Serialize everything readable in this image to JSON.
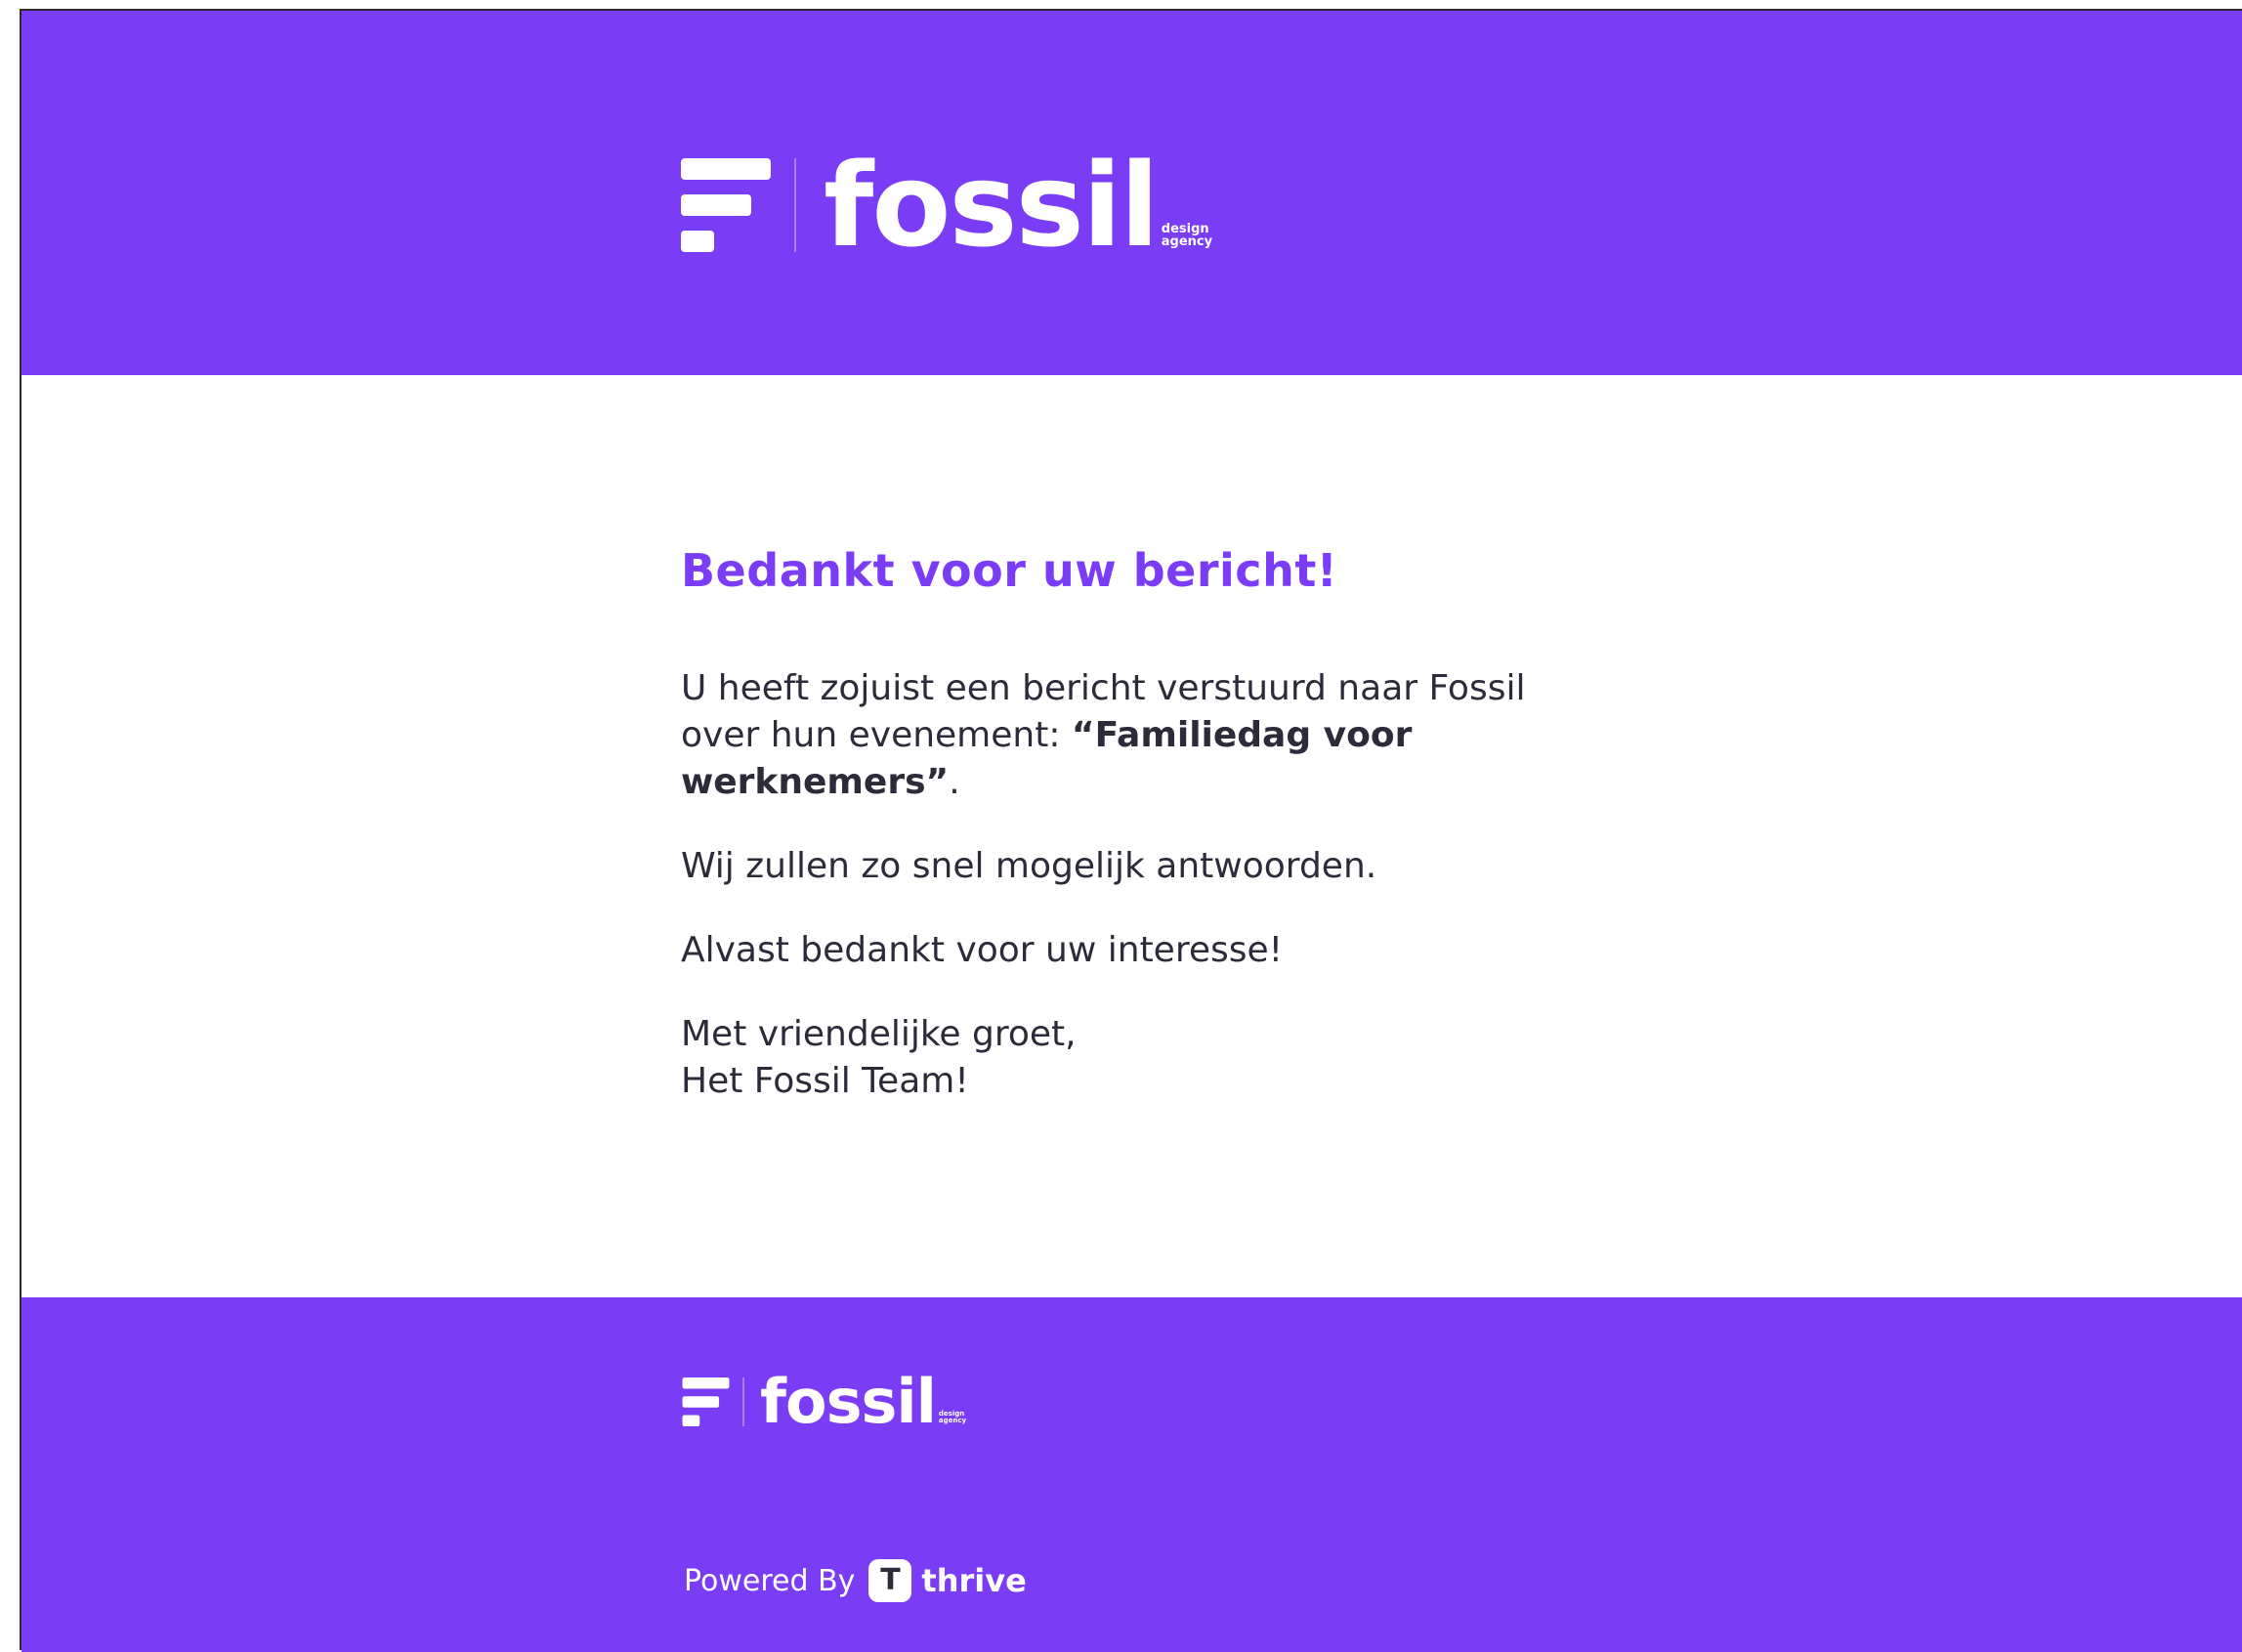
{
  "colors": {
    "brand": "#7a3cf5",
    "text": "#2b2b3a",
    "background": "#ffffff"
  },
  "header": {
    "logo": {
      "icon": "fossil-bars-logo-icon",
      "word": "fossil",
      "sub_line1": "design",
      "sub_line2": "agency"
    }
  },
  "main": {
    "heading": "Bedankt voor uw bericht!",
    "intro_text": "U heeft zojuist een bericht verstuurd naar Fossil over hun evenement: ",
    "event_name": "“Familiedag voor werknemers”",
    "intro_end": ".",
    "reply_text": "Wij zullen zo snel mogelijk antwoorden.",
    "thanks_text": "Alvast bedankt voor uw interesse!",
    "closing_line1": "Met vriendelijke groet,",
    "closing_line2": "Het Fossil Team!"
  },
  "footer": {
    "logo": {
      "icon": "fossil-bars-logo-icon",
      "word": "fossil",
      "sub_line1": "design",
      "sub_line2": "agency"
    },
    "powered_by": {
      "label": "Powered By",
      "icon": "thrive-logo-icon",
      "icon_letter": "T",
      "brand": "thrive"
    }
  }
}
